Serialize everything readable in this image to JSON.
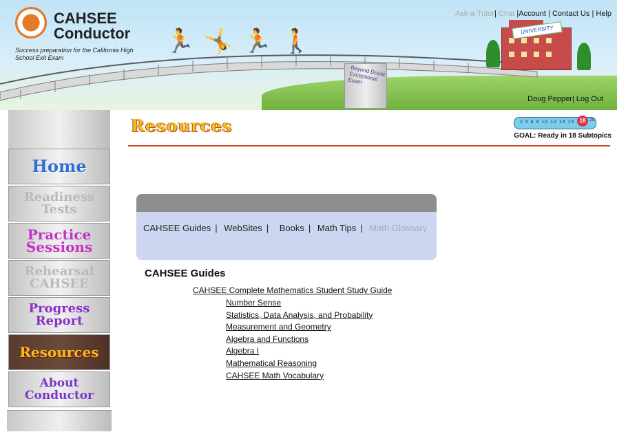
{
  "brand": {
    "line1": "CAHSEE",
    "line2": "Conductor",
    "tagline": "Success preparation for the California High School Exit Exam"
  },
  "top_links": {
    "ask": "Ask-a-Tutor",
    "chat": "Chat",
    "account": "Account",
    "contact": "Contact Us",
    "help": "Help"
  },
  "user": {
    "name": "Doug Pepper",
    "logout": "Log Out"
  },
  "scene": {
    "pillar_text": "Beyond Doubt Exceptional Exam",
    "university": "UNIVERSITY"
  },
  "nav": {
    "home": "Home",
    "readiness": "Readiness Tests",
    "practice": "Practice Sessions",
    "rehearsal": "Rehearsal CAHSEE",
    "progress": "Progress Report",
    "resources": "Resources",
    "about": "About Conductor"
  },
  "page_heading": "Resources",
  "goal": {
    "ticks": "2 4 6 8 10 12 14 16",
    "current": "18",
    "end": "20",
    "label": "GOAL:  Ready in 18 Subtopics"
  },
  "tabs": {
    "guides": "CAHSEE Guides",
    "websites": "WebSites",
    "books": "Books",
    "math_tips": "Math Tips",
    "glossary": "Math Glossary"
  },
  "section": {
    "title": "CAHSEE Guides",
    "guide": "CAHSEE Complete Mathematics Student Study Guide",
    "items": [
      "Number Sense",
      "Statistics, Data Analysis, and Probability",
      "Measurement and Geometry",
      "Algebra and Functions",
      "Algebra I",
      "Mathematical Reasoning",
      "CAHSEE Math Vocabulary"
    ]
  },
  "colors": {
    "accent_rule": "#c94a2a",
    "panel": "#cdd6f0",
    "panel_top": "#8e8e8e",
    "resources_text": "#e9c21a"
  }
}
